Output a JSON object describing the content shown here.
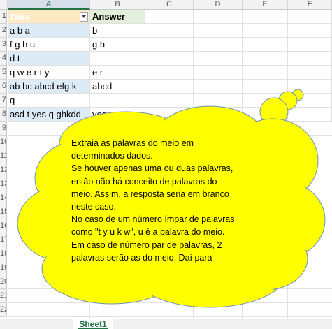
{
  "columns": [
    "A",
    "B",
    "C",
    "D",
    "E",
    "F"
  ],
  "rows": [
    "1",
    "2",
    "3",
    "4",
    "5",
    "6",
    "7",
    "8",
    "9",
    "10",
    "11",
    "12",
    "13",
    "14",
    "15",
    "16",
    "17",
    "18",
    "19",
    "20",
    "21",
    "22"
  ],
  "table": {
    "header_data": "Data",
    "header_answer": "Answer",
    "data": [
      "a b a",
      "f g h u",
      "d t",
      "q w e r t y",
      "ab bc abcd efg k",
      "q",
      "asd t yes q ghkdd"
    ],
    "answers": [
      "b",
      "g h",
      "",
      "e r",
      "abcd",
      "",
      "yes"
    ]
  },
  "callout": {
    "lines": [
      "Extraia as palavras do meio em",
      "determinados dados.",
      "Se houver apenas uma ou duas palavras,",
      "então não há conceito de palavras do",
      "meio. Assim, a resposta seria em branco",
      "neste caso.",
      "No caso de um número ímpar de palavras",
      "como \"t y u k w\", u é a palavra do meio.",
      "Em caso de número par de palavras, 2",
      "palavras serão as do meio. Daí para"
    ]
  },
  "sheet_tab": "Sheet1",
  "colors": {
    "cloud_fill": "#ffff00",
    "cloud_stroke": "#6f8fc0",
    "table_band": "#ddebf7",
    "accent": "#217346"
  }
}
